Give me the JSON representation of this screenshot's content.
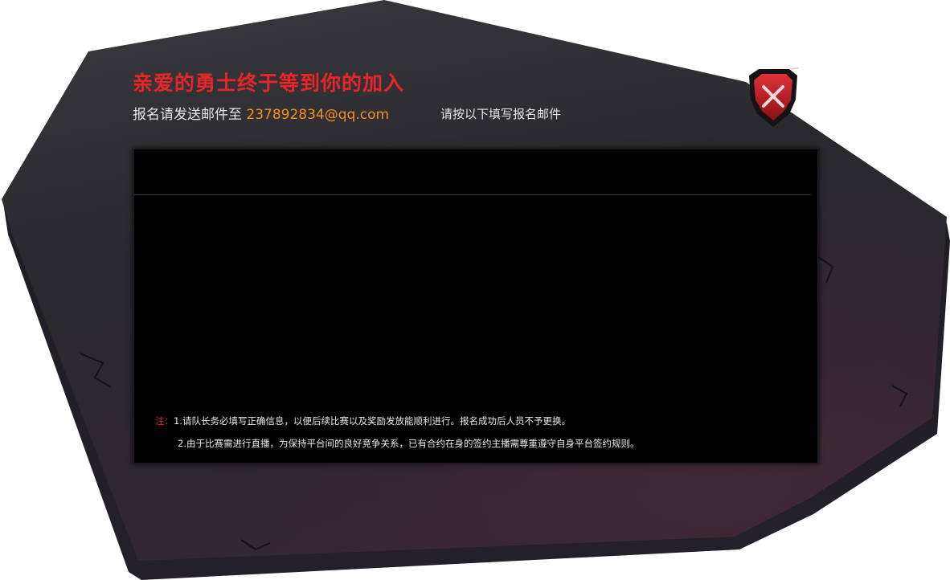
{
  "dialog": {
    "title": "亲爱的勇士终于等到你的加入",
    "email_prefix": "报名请发送邮件至",
    "email_address": "237892834@qq.com",
    "instruction": "请按以下填写报名邮件"
  },
  "notes": {
    "prefix": "注：",
    "items": [
      "1.请队长务必填写正确信息，以便后续比赛以及奖励发放能顺利进行。报名成功后人员不予更换。",
      "2.由于比赛需进行直播，为保持平台间的良好竞争关系，已有合约在身的签约主播需尊重遵守自身平台签约规则。"
    ]
  },
  "icons": {
    "close": "close-icon"
  },
  "colors": {
    "title": "#e8262a",
    "email": "#f0921c",
    "text": "#e6e6e6",
    "panel": "#000000",
    "slab": "#2a2a2e",
    "close_shield": "#c21b22"
  }
}
